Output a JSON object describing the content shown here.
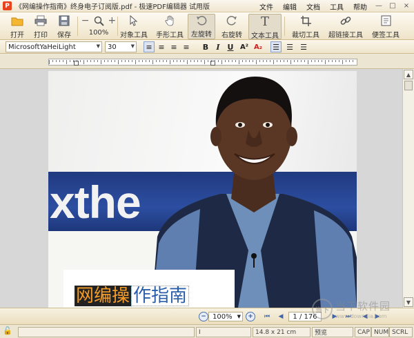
{
  "window": {
    "title": "《网编操作指南》终身电子订阅版.pdf - 极速PDF编辑器 试用版",
    "menus": [
      "文件",
      "编辑",
      "文档",
      "工具",
      "帮助"
    ],
    "controls": [
      "—",
      "□",
      "×"
    ]
  },
  "toolbar": {
    "open": "打开",
    "print": "打印",
    "save": "保存",
    "zoom": "100%",
    "object_tool": "对象工具",
    "hand_tool": "手形工具",
    "rotate_left": "左旋转",
    "rotate_right": "右旋转",
    "text_tool": "文本工具",
    "crop_tool": "裁切工具",
    "link_tool": "超链接工具",
    "note_tool": "便签工具"
  },
  "format": {
    "font": "MicrosoftYaHeiLight",
    "size": "30",
    "bold": "B",
    "italic": "I",
    "underline": "U",
    "superscript": "A²",
    "subscript": "A₂"
  },
  "document": {
    "banner_text": "xthe",
    "caption_left": "网编操",
    "caption_right": "作指南"
  },
  "nav": {
    "zoom": "100%",
    "page": "1 / 176"
  },
  "status": {
    "cursor": "I",
    "page_size": "14.8 x 21 cm",
    "mode": "预览",
    "cap": "CAP",
    "num": "NUM",
    "scrl": "SCRL"
  },
  "watermark": {
    "logo": "当下",
    "text": "当下软件园",
    "url": "www.downxia.com"
  },
  "colors": {
    "toolbar_bg": "#f3ead3",
    "caption_orange": "#f39c2a",
    "caption_blue": "#2b5ea8",
    "banner_blue": "#2c4ea1"
  }
}
